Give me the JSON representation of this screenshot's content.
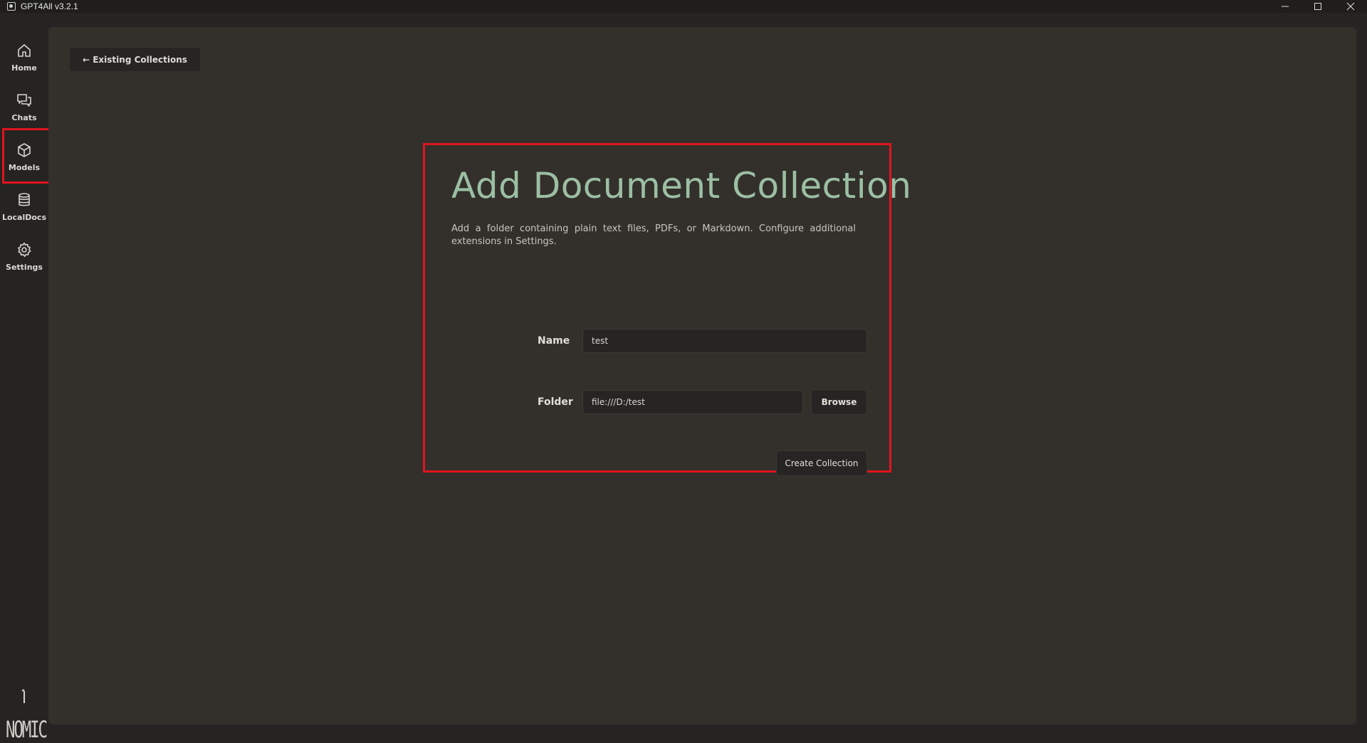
{
  "window": {
    "title": "GPT4All v3.2.1"
  },
  "sidebar": {
    "items": [
      {
        "label": "Home",
        "icon": "home-icon"
      },
      {
        "label": "Chats",
        "icon": "chats-icon"
      },
      {
        "label": "Models",
        "icon": "models-cube-icon"
      },
      {
        "label": "LocalDocs",
        "icon": "database-icon"
      },
      {
        "label": "Settings",
        "icon": "gear-icon"
      }
    ],
    "logo_text": "NOMIC"
  },
  "main": {
    "back_button": "← Existing Collections",
    "heading": "Add Document Collection",
    "description": "Add a folder containing plain text files, PDFs, or Markdown. Configure additional extensions in Settings.",
    "name_label": "Name",
    "name_value": "test",
    "folder_label": "Folder",
    "folder_value": "file:///D:/test",
    "browse_button": "Browse",
    "create_button": "Create Collection"
  },
  "colors": {
    "heading_accent": "#9cbfa3",
    "highlight": "#e0141e",
    "panel_bg": "#33302c",
    "app_bg": "#252422"
  }
}
